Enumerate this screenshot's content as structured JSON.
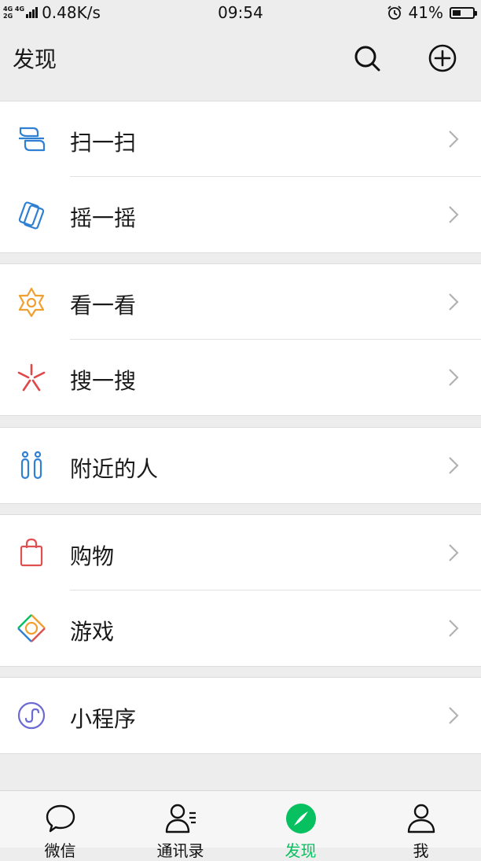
{
  "status_bar": {
    "network_top": "4G 4G",
    "network_bottom": "2G",
    "speed": "0.48K/s",
    "time": "09:54",
    "alarm_icon": "alarm-clock-icon",
    "battery_percent": "41%",
    "battery_level": 0.41
  },
  "header": {
    "title": "发现",
    "search_icon": "search-icon",
    "add_icon": "plus-circle-icon"
  },
  "groups": [
    {
      "items": [
        {
          "label": "扫一扫",
          "icon": "scan-icon",
          "color": "#2f7fd2"
        },
        {
          "label": "摇一摇",
          "icon": "shake-icon",
          "color": "#2f7fd2"
        }
      ]
    },
    {
      "items": [
        {
          "label": "看一看",
          "icon": "top-stories-icon",
          "color": "#f0a030"
        },
        {
          "label": "搜一搜",
          "icon": "search-search-icon",
          "color": "#e04848"
        }
      ]
    },
    {
      "items": [
        {
          "label": "附近的人",
          "icon": "people-nearby-icon",
          "color": "#2f7fd2"
        }
      ]
    },
    {
      "items": [
        {
          "label": "购物",
          "icon": "shopping-bag-icon",
          "color": "#e05050"
        },
        {
          "label": "游戏",
          "icon": "games-icon",
          "color": "#f0a030"
        }
      ]
    },
    {
      "items": [
        {
          "label": "小程序",
          "icon": "mini-programs-icon",
          "color": "#6a6ad2"
        }
      ]
    }
  ],
  "tabbar": {
    "active_color": "#07c160",
    "tabs": [
      {
        "label": "微信",
        "icon": "chat-bubble-icon"
      },
      {
        "label": "通讯录",
        "icon": "contacts-icon"
      },
      {
        "label": "发现",
        "icon": "compass-icon",
        "active": true
      },
      {
        "label": "我",
        "icon": "person-icon"
      }
    ]
  }
}
